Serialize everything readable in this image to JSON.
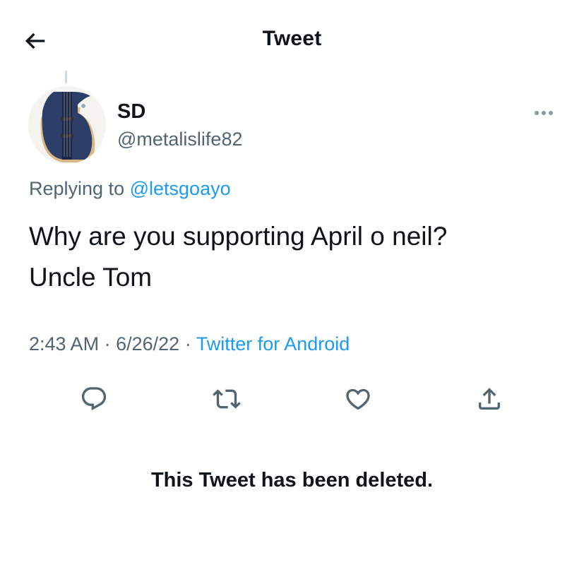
{
  "header": {
    "back_icon": "arrow-left-icon",
    "title": "Tweet"
  },
  "tweet": {
    "avatar": "guitar-avatar",
    "display_name": "SD",
    "handle": "@metalislife82",
    "replying_prefix": "Replying to",
    "replying_to": "@letsgoayo",
    "text_line1": "Why are you supporting April o neil?",
    "text_line2": "Uncle Tom",
    "time": "2:43 AM",
    "date": "6/26/22",
    "source": "Twitter for Android",
    "separator": "·"
  },
  "actions": [
    "reply-icon",
    "retweet-icon",
    "like-icon",
    "share-icon"
  ],
  "notice": "This Tweet has been deleted.",
  "colors": {
    "link": "#1d9bf0",
    "secondary_text": "#536471",
    "primary_text": "#0f1419"
  }
}
